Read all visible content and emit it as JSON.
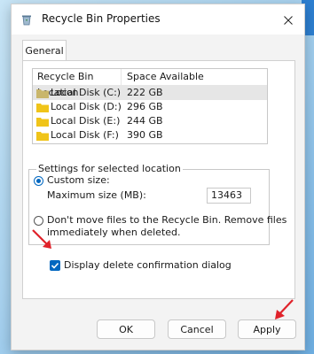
{
  "window": {
    "title": "Recycle Bin Properties"
  },
  "tabs": [
    {
      "label": "General"
    }
  ],
  "list": {
    "headers": [
      "Recycle Bin Location",
      "Space Available"
    ],
    "rows": [
      {
        "location": "Local Disk (C:)",
        "space": "222 GB"
      },
      {
        "location": "Local Disk (D:)",
        "space": "296 GB"
      },
      {
        "location": "Local Disk (E:)",
        "space": "244 GB"
      },
      {
        "location": "Local Disk (F:)",
        "space": "390 GB"
      }
    ]
  },
  "settings": {
    "group_label": "Settings for selected location",
    "custom_size_label": "Custom size:",
    "max_size_label": "Maximum size (MB):",
    "max_size_value": "13463",
    "dont_move_line1": "Don't move files to the Recycle Bin. Remove files",
    "dont_move_line2": "immediately when deleted."
  },
  "confirm_label": "Display delete confirmation dialog",
  "buttons": {
    "ok": "OK",
    "cancel": "Cancel",
    "apply": "Apply"
  },
  "colors": {
    "accent": "#0067c0",
    "arrow": "#e0222a",
    "folder": "#f0c419"
  }
}
